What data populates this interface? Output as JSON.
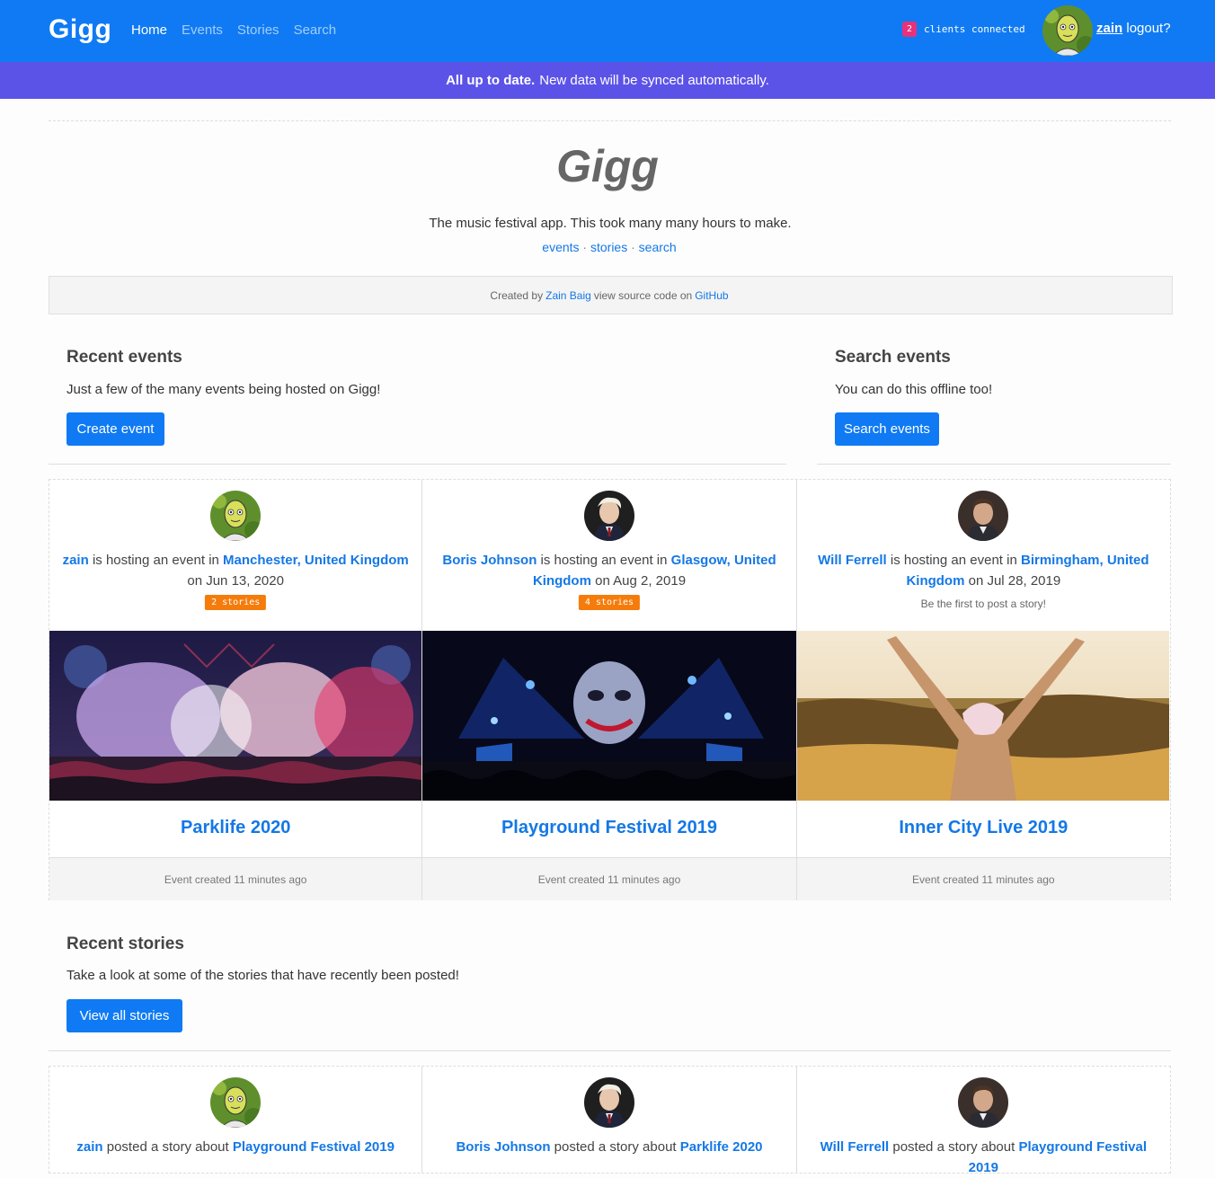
{
  "navbar": {
    "brand": "Gigg",
    "links": [
      "Home",
      "Events",
      "Stories",
      "Search"
    ],
    "clients_count": "2",
    "clients_label": "clients connected",
    "username": "zain",
    "logout": "logout?"
  },
  "sync": {
    "strong": "All up to date.",
    "text": "New data will be synced automatically."
  },
  "hero": {
    "title": "Gigg",
    "subtitle": "The music festival app. This took many many hours to make.",
    "links": [
      "events",
      "stories",
      "search"
    ],
    "separator": "·",
    "credits_prefix": "Created by",
    "credits_author": "Zain Baig",
    "credits_middle": "view source code on",
    "credits_repo": "GitHub"
  },
  "recent_events": {
    "title": "Recent events",
    "desc": "Just a few of the many events being hosted on Gigg!",
    "button": "Create event"
  },
  "search_events": {
    "title": "Search events",
    "desc": "You can do this offline too!",
    "button": "Search events"
  },
  "events": [
    {
      "host": "zain",
      "mid": "is hosting an event in",
      "location": "Manchester, United Kingdom",
      "on": "on",
      "date": "Jun 13, 2020",
      "stories": "2 stories",
      "title": "Parklife 2020",
      "footer": "Event created 11 minutes ago"
    },
    {
      "host": "Boris Johnson",
      "mid": "is hosting an event in",
      "location": "Glasgow, United Kingdom",
      "on": "on",
      "date": "Aug 2, 2019",
      "stories": "4 stories",
      "title": "Playground Festival 2019",
      "footer": "Event created 11 minutes ago"
    },
    {
      "host": "Will Ferrell",
      "mid": "is hosting an event in",
      "location": "Birmingham, United Kingdom",
      "on": "on",
      "date": "Jul 28, 2019",
      "first_story": "Be the first to post a story!",
      "title": "Inner City Live 2019",
      "footer": "Event created 11 minutes ago"
    }
  ],
  "recent_stories": {
    "title": "Recent stories",
    "desc": "Take a look at some of the stories that have recently been posted!",
    "button": "View all stories"
  },
  "stories": [
    {
      "author": "zain",
      "mid": "posted a story about",
      "event": "Playground Festival 2019"
    },
    {
      "author": "Boris Johnson",
      "mid": "posted a story about",
      "event": "Parklife 2020"
    },
    {
      "author": "Will Ferrell",
      "mid": "posted a story about",
      "event": "Playground Festival 2019"
    }
  ],
  "colors": {
    "navbar": "#0f7af4",
    "sync_banner": "#5b53e8",
    "link": "#1478e6",
    "story_badge": "#f57c0b",
    "clients_badge": "#e6327a"
  }
}
